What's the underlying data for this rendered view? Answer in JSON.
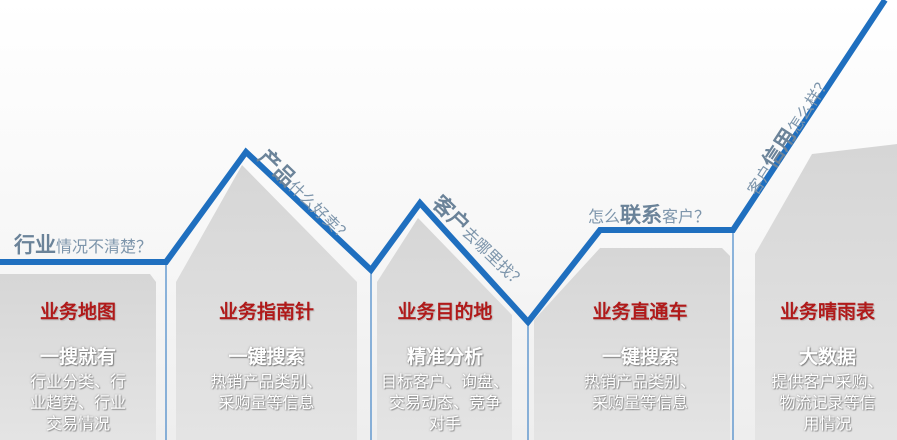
{
  "colors": {
    "line": "#1f6fbf",
    "panel": "#dcdcdc",
    "title_red": "#b01a1a",
    "question_text": "#7d95ab"
  },
  "questions": [
    {
      "strong": "行业",
      "rest": "情况不清楚？"
    },
    {
      "strong": "产品",
      "rest": "什么好卖？"
    },
    {
      "strong": "客户",
      "rest": "去哪里找？"
    },
    {
      "pre": "怎么",
      "strong": "联系",
      "rest": "客户？"
    },
    {
      "pre": "客户",
      "strong": "信用",
      "rest": "怎么样？"
    }
  ],
  "columns": [
    {
      "name": "业务地图",
      "headline": "一搜就有",
      "desc": [
        "行业分类、行",
        "业趋势、行业",
        "交易情况"
      ]
    },
    {
      "name": "业务指南针",
      "headline": "一键搜索",
      "desc": [
        "热销产品类别、",
        "采购量等信息"
      ]
    },
    {
      "name": "业务目的地",
      "headline": "精准分析",
      "desc": [
        "目标客户、询盘、",
        "交易动态、竞争",
        "对手"
      ]
    },
    {
      "name": "业务直通车",
      "headline": "一键搜索",
      "desc": [
        "热销产品类别、",
        "采购量等信息"
      ]
    },
    {
      "name": "业务晴雨表",
      "headline": "大数据",
      "desc": [
        "提供客户采购、",
        "物流记录等信",
        "用情况"
      ]
    }
  ]
}
